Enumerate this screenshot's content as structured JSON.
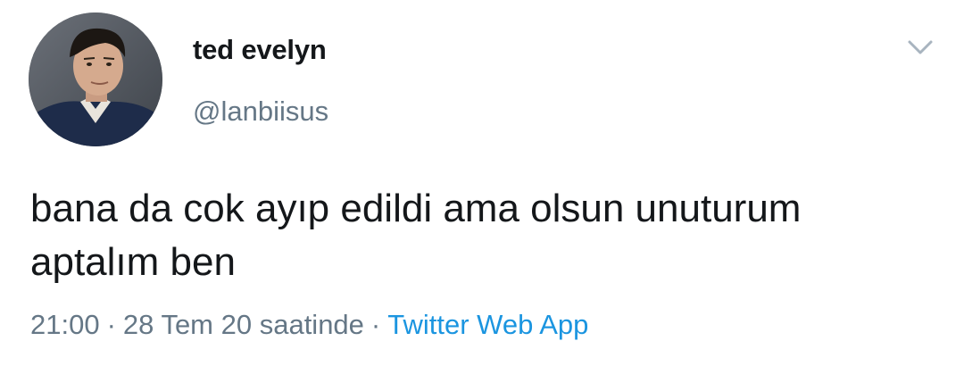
{
  "tweet": {
    "display_name": "ted evelyn",
    "handle": "@lanbiisus",
    "text": "bana da cok ayıp edildi ama olsun unuturum aptalım ben",
    "time": "21:00",
    "date": "28 Tem 20 saatinde",
    "separator": "·",
    "source": "Twitter Web App"
  },
  "icons": {
    "caret": "chevron-down-icon",
    "avatar": "profile-photo"
  },
  "colors": {
    "name": "#14171a",
    "secondary": "#657786",
    "link": "#1b95e0",
    "background": "#ffffff"
  }
}
